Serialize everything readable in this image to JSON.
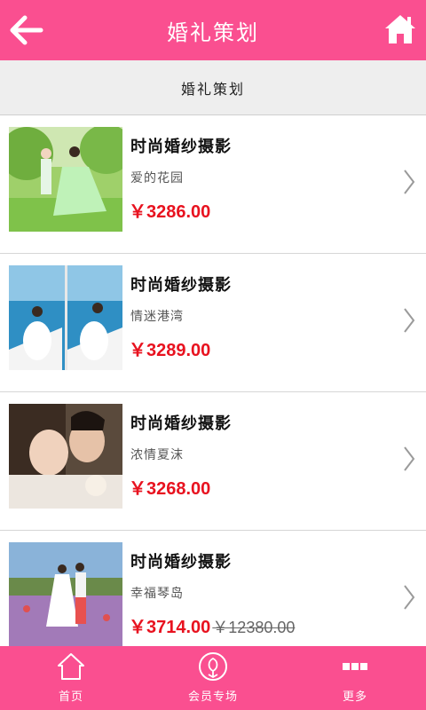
{
  "header": {
    "title": "婚礼策划",
    "back_icon": "back-arrow-icon",
    "home_icon": "home-icon"
  },
  "subheader": {
    "label": "婚礼策划"
  },
  "products": [
    {
      "name": "时尚婚纱摄影",
      "subtitle": "爱的花园",
      "price": "￥3286.00",
      "old_price": ""
    },
    {
      "name": "时尚婚纱摄影",
      "subtitle": "情迷港湾",
      "price": "￥3289.00",
      "old_price": ""
    },
    {
      "name": "时尚婚纱摄影",
      "subtitle": "浓情夏沫",
      "price": "￥3268.00",
      "old_price": ""
    },
    {
      "name": "时尚婚纱摄影",
      "subtitle": "幸福琴岛",
      "price": "￥3714.00",
      "old_price": "￥12380.00"
    }
  ],
  "tabbar": {
    "items": [
      {
        "label": "首页",
        "icon": "home-outline-icon"
      },
      {
        "label": "会员专场",
        "icon": "flower-badge-icon"
      },
      {
        "label": "更多",
        "icon": "more-dots-icon"
      }
    ]
  },
  "colors": {
    "brand": "#fa4f90",
    "price": "#e8121f"
  }
}
